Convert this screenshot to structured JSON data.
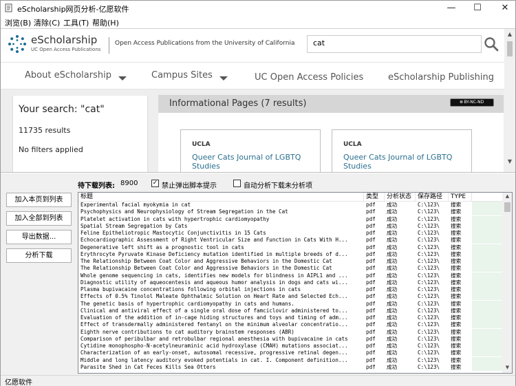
{
  "window": {
    "title": "eScholarship网页分析-亿愿软件",
    "controls": [
      "—",
      "☐",
      "✕"
    ]
  },
  "menu": [
    "浏览(B)",
    "清除(C)",
    "工具(T)",
    "帮助(H)"
  ],
  "site": {
    "logo_title": "eScholarship",
    "logo_subtitle": "UC Open Access Publications",
    "tagline": "Open Access Publications from the University of California",
    "search_value": "cat",
    "nav": [
      "About eScholarship",
      "Campus Sites",
      "UC Open Access Policies",
      "eScholarship Publishing"
    ],
    "search_card": {
      "heading": "Your search: \"cat\"",
      "results": "11735 results",
      "filters": "No filters applied"
    },
    "info": {
      "title": "Informational Pages (7 results)",
      "license": "BY-NC-ND",
      "cards": [
        {
          "campus": "UCLA",
          "title": "Queer Cats Journal of LGBTQ Studies"
        },
        {
          "campus": "UCLA",
          "title": "Queer Cats Journal of LGBTQ Studies"
        }
      ]
    }
  },
  "panel": {
    "pending_label": "待下载列表:",
    "pending_count": "8900",
    "opt_block_popups": "禁止弹出脚本提示",
    "opt_block_popups_checked": "✓",
    "opt_auto_download": "自动分析下载未分析项",
    "buttons": [
      "加入本页到列表",
      "加入全部到列表",
      "导出数据...",
      "分析下载"
    ],
    "columns": [
      "标题",
      "类型",
      "分析状态",
      "保存路径",
      "TYPE"
    ],
    "rows": [
      {
        "title": "Experimental facial myokymia in cat",
        "type": "pdf",
        "status": "成功",
        "path": "C:\\123\\",
        "tag": "搜索"
      },
      {
        "title": "Psychophysics and Neurophysiology of Stream Segregation in the Cat",
        "type": "pdf",
        "status": "成功",
        "path": "C:\\123\\",
        "tag": "搜索"
      },
      {
        "title": "Platelet activation in cats with hypertrophic cardiomyopathy",
        "type": "pdf",
        "status": "成功",
        "path": "C:\\123\\",
        "tag": "搜索"
      },
      {
        "title": "Spatial Stream Segregation by Cats",
        "type": "pdf",
        "status": "成功",
        "path": "C:\\123\\",
        "tag": "搜索"
      },
      {
        "title": "Feline Epitheliotropic Mastocytic Conjunctivitis in 15 Cats",
        "type": "pdf",
        "status": "成功",
        "path": "C:\\123\\",
        "tag": "搜索"
      },
      {
        "title": "Echocardiographic Assessment of Right Ventricular Size and Function in Cats With H...",
        "type": "pdf",
        "status": "成功",
        "path": "C:\\123\\",
        "tag": "搜索"
      },
      {
        "title": "Degenerative left shift as a prognostic tool in cats",
        "type": "pdf",
        "status": "成功",
        "path": "C:\\123\\",
        "tag": "搜索"
      },
      {
        "title": "Erythrocyte Pyruvate Kinase Deficiency mutation identified in multiple breeds of d...",
        "type": "pdf",
        "status": "成功",
        "path": "C:\\123\\",
        "tag": "搜索"
      },
      {
        "title": "The Relationship Between Coat Color and Aggressive Behaviors in the Domestic Cat",
        "type": "pdf",
        "status": "成功",
        "path": "C:\\123\\",
        "tag": "搜索"
      },
      {
        "title": "The Relationship Between Coat Color and Aggressive Behaviors in the Domestic Cat",
        "type": "pdf",
        "status": "成功",
        "path": "C:\\123\\",
        "tag": "搜索"
      },
      {
        "title": "Whole genome sequencing in cats, identifies new models for blindness in AIPL1 and ...",
        "type": "pdf",
        "status": "成功",
        "path": "C:\\123\\",
        "tag": "搜索"
      },
      {
        "title": "Diagnostic utility of aqueocentesis and aqueous humor analysis in dogs and cats wi...",
        "type": "pdf",
        "status": "成功",
        "path": "C:\\123\\",
        "tag": "搜索"
      },
      {
        "title": "Plasma bupivacaine concentrations following orbital injections in cats",
        "type": "pdf",
        "status": "成功",
        "path": "C:\\123\\",
        "tag": "搜索"
      },
      {
        "title": "Effects of 0.5% Tinolol Maleate Ophthalmic Solution on Heart Rate and Selected Ech...",
        "type": "pdf",
        "status": "成功",
        "path": "C:\\123\\",
        "tag": "搜索"
      },
      {
        "title": "The genetic basis of hypertrophic cardiomyopathy in cats and humans.",
        "type": "pdf",
        "status": "成功",
        "path": "C:\\123\\",
        "tag": "搜索"
      },
      {
        "title": "Clinical and antiviral effect of a single oral dose of famciclovir administered to...",
        "type": "pdf",
        "status": "成功",
        "path": "C:\\123\\",
        "tag": "搜索"
      },
      {
        "title": "Evaluation of the addition of in-cage hiding structures and toys and timing of adm...",
        "type": "pdf",
        "status": "成功",
        "path": "C:\\123\\",
        "tag": "搜索"
      },
      {
        "title": "Effect of transdermally administered fentanyl on the minimum alveolar concentratio...",
        "type": "pdf",
        "status": "成功",
        "path": "C:\\123\\",
        "tag": "搜索"
      },
      {
        "title": "Eighth nerve contributions to cat auditory brainstem responses (ABR)",
        "type": "pdf",
        "status": "成功",
        "path": "C:\\123\\",
        "tag": "搜索"
      },
      {
        "title": "Comparison of peribulbar and retrobulbar regional anesthesia with bupivacaine in cats",
        "type": "pdf",
        "status": "成功",
        "path": "C:\\123\\",
        "tag": "搜索"
      },
      {
        "title": "Cytidine monophospho-N-acetylneuraminic acid hydroxylase (CMAH) mutations associat...",
        "type": "pdf",
        "status": "成功",
        "path": "C:\\123\\",
        "tag": "搜索"
      },
      {
        "title": "Characterization of an early-onset, autosomal recessive, progressive retinal degen...",
        "type": "pdf",
        "status": "成功",
        "path": "C:\\123\\",
        "tag": "搜索"
      },
      {
        "title": "Middle and long latency auditory evoked potentials in cat. I. Component definition...",
        "type": "pdf",
        "status": "成功",
        "path": "C:\\123\\",
        "tag": "搜索"
      },
      {
        "title": "Parasite Shed in Cat Feces Kills Sea Otters",
        "type": "pdf",
        "status": "成功",
        "path": "C:\\123\\",
        "tag": "搜索"
      }
    ]
  },
  "status_bar": "亿愿软件"
}
